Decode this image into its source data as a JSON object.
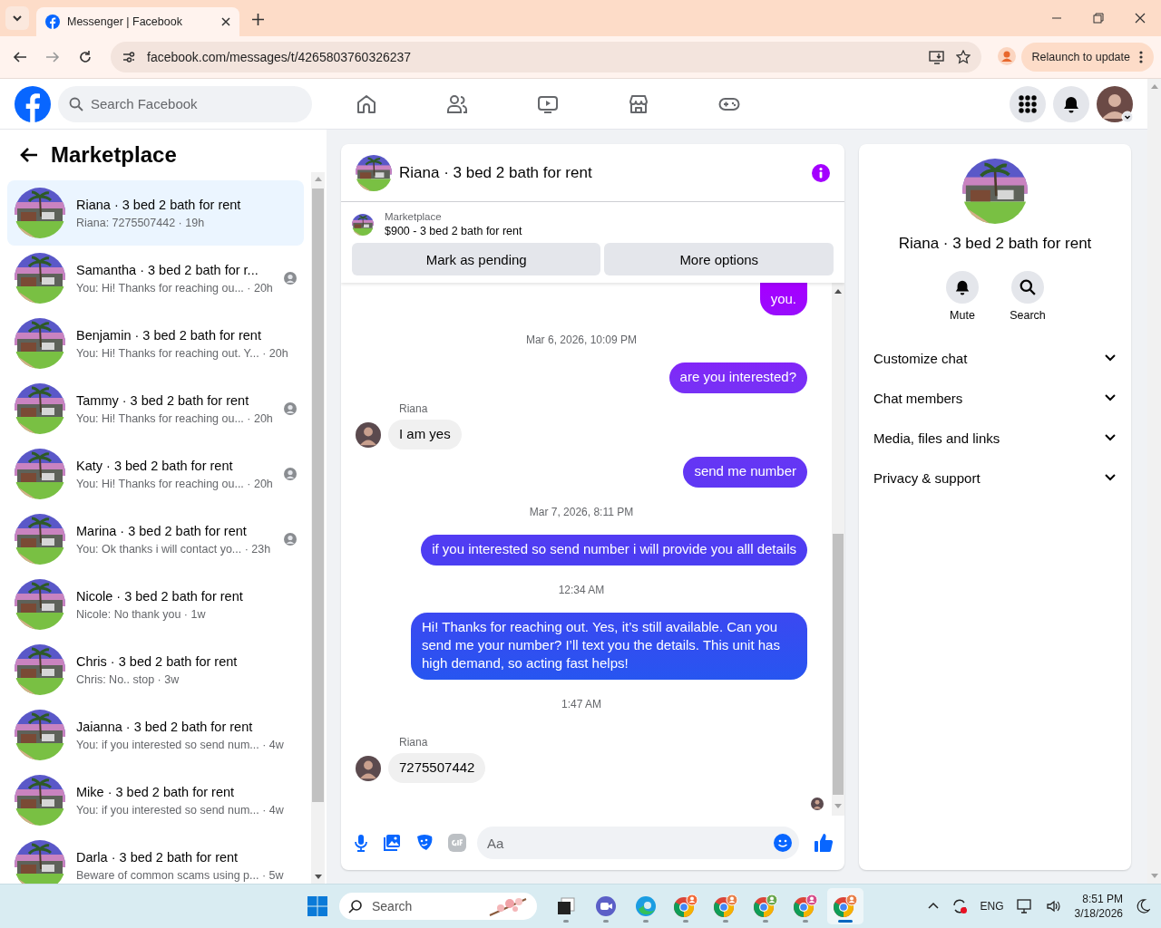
{
  "browser": {
    "tab_title": "Messenger | Facebook",
    "url": "facebook.com/messages/t/4265803760326237",
    "relaunch_button": "Relaunch to update"
  },
  "topbar": {
    "search_placeholder": "Search Facebook"
  },
  "sidebar": {
    "title": "Marketplace",
    "conversations": [
      {
        "title": "Riana · 3 bed 2 bath for rent",
        "preview": "Riana: 7275507442 · 19h",
        "selected": true,
        "seen": false
      },
      {
        "title": "Samantha · 3 bed 2 bath for r...",
        "preview": "You: Hi! Thanks for reaching ou... · 20h",
        "selected": false,
        "seen": true
      },
      {
        "title": "Benjamin · 3 bed 2 bath for rent",
        "preview": "You: Hi! Thanks for reaching out. Y... · 20h",
        "selected": false,
        "seen": false
      },
      {
        "title": "Tammy · 3 bed 2 bath for rent",
        "preview": "You: Hi! Thanks for reaching ou... · 20h",
        "selected": false,
        "seen": true
      },
      {
        "title": "Katy · 3 bed 2 bath for rent",
        "preview": "You: Hi! Thanks for reaching ou... · 20h",
        "selected": false,
        "seen": true
      },
      {
        "title": "Marina · 3 bed 2 bath for rent",
        "preview": "You: Ok thanks i will contact yo... · 23h",
        "selected": false,
        "seen": true
      },
      {
        "title": "Nicole · 3 bed 2 bath for rent",
        "preview": "Nicole: No thank you · 1w",
        "selected": false,
        "seen": false
      },
      {
        "title": "Chris · 3 bed 2 bath for rent",
        "preview": "Chris: No.. stop · 3w",
        "selected": false,
        "seen": false
      },
      {
        "title": "Jaianna · 3 bed 2 bath for rent",
        "preview": "You: if you interested so send num... · 4w",
        "selected": false,
        "seen": false
      },
      {
        "title": "Mike · 3 bed 2 bath for rent",
        "preview": "You: if you interested so send num... · 4w",
        "selected": false,
        "seen": false
      },
      {
        "title": "Darla · 3 bed 2 bath for rent",
        "preview": "Beware of common scams using p... · 5w",
        "selected": false,
        "seen": false
      }
    ]
  },
  "chat": {
    "title": "Riana · 3 bed 2 bath for rent",
    "listing_label": "Marketplace",
    "listing_title": "$900 - 3 bed 2 bath for rent",
    "buttons": [
      "Mark as pending",
      "More options"
    ],
    "messages": [
      {
        "kind": "outgoing",
        "text": "you."
      },
      {
        "kind": "timestamp",
        "text": "Mar 6, 2026, 10:09 PM"
      },
      {
        "kind": "outgoing",
        "text": "are you interested?"
      },
      {
        "kind": "incoming",
        "sender": "Riana",
        "text": "I am yes"
      },
      {
        "kind": "outgoing",
        "text": "send me number"
      },
      {
        "kind": "timestamp",
        "text": "Mar 7, 2026, 8:11 PM"
      },
      {
        "kind": "outgoing",
        "text": "if you interested so send number i will provide you alll details"
      },
      {
        "kind": "timestamp",
        "text": "12:34 AM"
      },
      {
        "kind": "outgoing",
        "text": "Hi! Thanks for reaching out. Yes, it’s still available. Can you send me your number? I’ll text you the details. This unit has high demand, so acting fast helps!"
      },
      {
        "kind": "timestamp",
        "text": "1:47 AM"
      },
      {
        "kind": "incoming",
        "sender": "Riana",
        "text": "7275507442"
      }
    ],
    "composer_placeholder": "Aa"
  },
  "info": {
    "title": "Riana · 3 bed 2 bath for rent",
    "actions": [
      {
        "kind": "mute",
        "label": "Mute"
      },
      {
        "kind": "search",
        "label": "Search"
      }
    ],
    "sections": [
      {
        "label": "Customize chat",
        "expanded": false
      },
      {
        "label": "Chat members",
        "expanded": false
      },
      {
        "label": "Media, files and links",
        "expanded": false
      },
      {
        "label": "Privacy & support",
        "expanded": false
      }
    ]
  },
  "taskbar": {
    "search_placeholder": "Search",
    "apps": [
      {
        "kind": "files",
        "selected": false
      },
      {
        "kind": "meet",
        "selected": false
      },
      {
        "kind": "edge",
        "selected": false
      },
      {
        "kind": "chrome",
        "selected": false,
        "color": "#f26b3a"
      },
      {
        "kind": "chrome",
        "selected": false,
        "color": "#e8804a"
      },
      {
        "kind": "chrome",
        "selected": false,
        "color": "#6aa84f"
      },
      {
        "kind": "chrome",
        "selected": false,
        "color": "#d64f8c"
      },
      {
        "kind": "chrome",
        "selected": true,
        "color": "#e8804a"
      }
    ],
    "language": "ENG",
    "time": "8:51 PM",
    "date": "3/18/2026"
  }
}
